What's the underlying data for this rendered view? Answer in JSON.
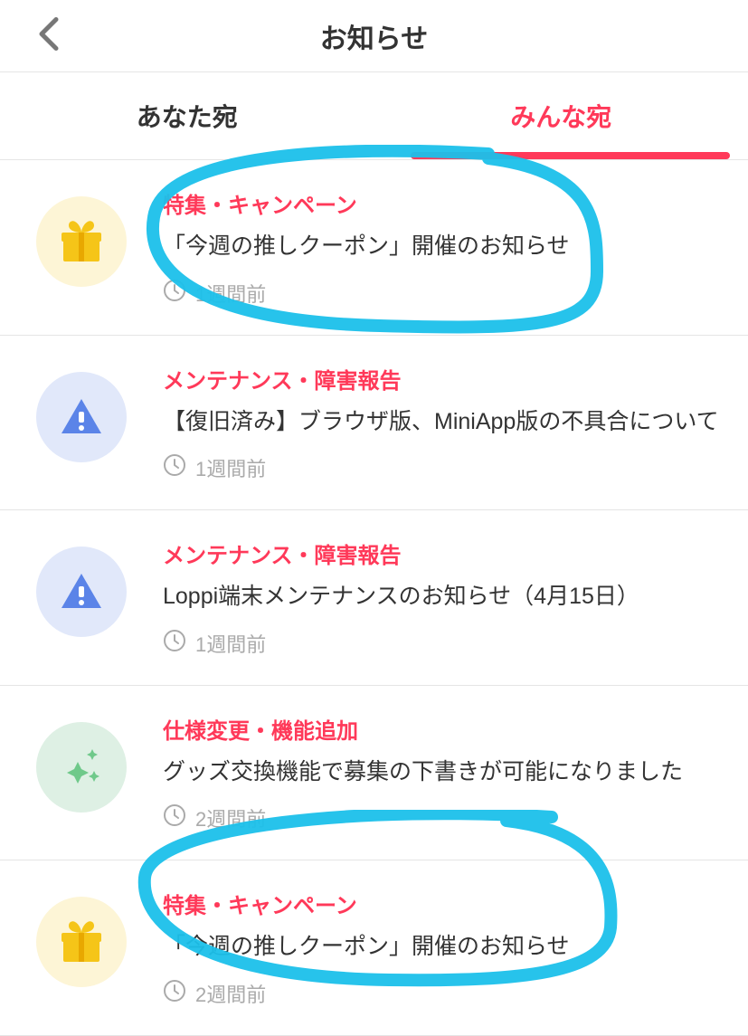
{
  "header": {
    "title": "お知らせ"
  },
  "tabs": [
    {
      "label": "あなた宛",
      "active": false
    },
    {
      "label": "みんな宛",
      "active": true
    }
  ],
  "items": [
    {
      "icon": "gift",
      "category": "特集・キャンペーン",
      "message": "「今週の推しクーポン」開催のお知らせ",
      "time": "1週間前",
      "highlighted": true
    },
    {
      "icon": "maint",
      "category": "メンテナンス・障害報告",
      "message": "【復旧済み】ブラウザ版、MiniApp版の不具合について",
      "time": "1週間前",
      "highlighted": false
    },
    {
      "icon": "maint",
      "category": "メンテナンス・障害報告",
      "message": "Loppi端末メンテナンスのお知らせ（4月15日）",
      "time": "1週間前",
      "highlighted": false
    },
    {
      "icon": "feature",
      "category": "仕様変更・機能追加",
      "message": "グッズ交換機能で募集の下書きが可能になりました",
      "time": "2週間前",
      "highlighted": false
    },
    {
      "icon": "gift",
      "category": "特集・キャンペーン",
      "message": "「今週の推しクーポン」開催のお知らせ",
      "time": "2週間前",
      "highlighted": true
    }
  ]
}
